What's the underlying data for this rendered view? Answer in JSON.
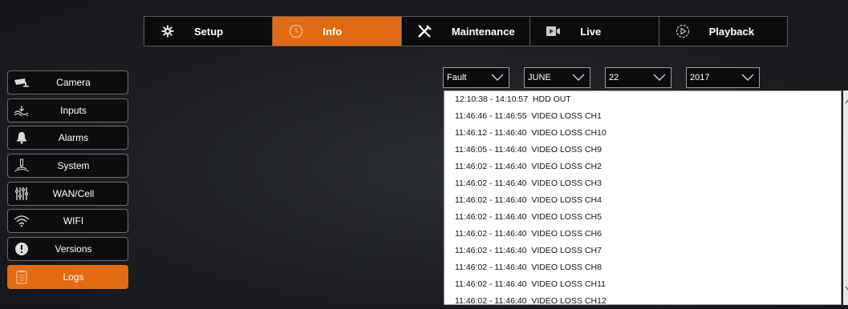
{
  "topnav": {
    "tabs": [
      {
        "label": "Setup",
        "icon": "gear-icon",
        "active": false
      },
      {
        "label": "Info",
        "icon": "clock-icon",
        "active": true
      },
      {
        "label": "Maintenance",
        "icon": "tools-icon",
        "active": false
      },
      {
        "label": "Live",
        "icon": "live-camera-icon",
        "active": false
      },
      {
        "label": "Playback",
        "icon": "playback-icon",
        "active": false
      }
    ]
  },
  "sidebar": {
    "items": [
      {
        "label": "Camera",
        "icon": "camera-icon"
      },
      {
        "label": "Inputs",
        "icon": "inputs-icon"
      },
      {
        "label": "Alarms",
        "icon": "bell-icon"
      },
      {
        "label": "System",
        "icon": "system-icon"
      },
      {
        "label": "WAN/Cell",
        "icon": "sliders-icon"
      },
      {
        "label": "WIFI",
        "icon": "wifi-icon"
      },
      {
        "label": "Versions",
        "icon": "info-icon"
      },
      {
        "label": "Logs",
        "icon": "logs-icon",
        "active": true
      }
    ]
  },
  "filters": {
    "type": "Fault",
    "month": "JUNE",
    "day": "22",
    "year": "2017"
  },
  "logs": [
    {
      "time": "12:10:38 - 14:10:57",
      "event": "HDD OUT"
    },
    {
      "time": "11:46:46 - 11:46:55",
      "event": "VIDEO LOSS CH1"
    },
    {
      "time": "11:46:12 - 11:46:40",
      "event": "VIDEO LOSS CH10"
    },
    {
      "time": "11:46:05 - 11:46:40",
      "event": "VIDEO LOSS CH9"
    },
    {
      "time": "11:46:02 - 11:46:40",
      "event": "VIDEO LOSS CH2"
    },
    {
      "time": "11:46:02 - 11:46:40",
      "event": "VIDEO LOSS CH3"
    },
    {
      "time": "11:46:02 - 11:46:40",
      "event": "VIDEO LOSS CH4"
    },
    {
      "time": "11:46:02 - 11:46:40",
      "event": "VIDEO LOSS CH5"
    },
    {
      "time": "11:46:02 - 11:46:40",
      "event": "VIDEO LOSS CH6"
    },
    {
      "time": "11:46:02 - 11:46:40",
      "event": "VIDEO LOSS CH7"
    },
    {
      "time": "11:46:02 - 11:46:40",
      "event": "VIDEO LOSS CH8"
    },
    {
      "time": "11:46:02 - 11:46:40",
      "event": "VIDEO LOSS CH11"
    },
    {
      "time": "11:46:02 - 11:46:40",
      "event": "VIDEO LOSS CH12"
    }
  ],
  "colors": {
    "accent": "#e06b12",
    "panel": "#0b0c0e",
    "border": "#5a5d62"
  }
}
